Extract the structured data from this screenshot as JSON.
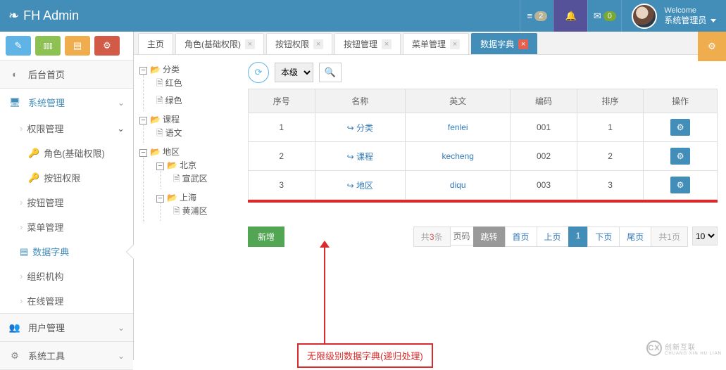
{
  "brand": "FH Admin",
  "nav": {
    "notif1_count": "2",
    "mail_count": "0",
    "welcome": "Welcome",
    "username": "系统管理员"
  },
  "sidebar": {
    "items": [
      {
        "icon": "◐",
        "label": "后台首页"
      },
      {
        "icon": "🖥",
        "label": "系统管理",
        "active": true
      },
      {
        "label": "权限管理"
      },
      {
        "label": "角色(基础权限)"
      },
      {
        "label": "按钮权限"
      },
      {
        "label": "按钮管理"
      },
      {
        "label": "菜单管理"
      },
      {
        "icon": "📘",
        "label": "数据字典",
        "selected": true
      },
      {
        "label": "组织机构"
      },
      {
        "label": "在线管理"
      },
      {
        "icon": "👥",
        "label": "用户管理"
      },
      {
        "icon": "⚙",
        "label": "系统工具"
      }
    ]
  },
  "tabs": [
    {
      "label": "主页",
      "closable": false
    },
    {
      "label": "角色(基础权限)",
      "closable": true
    },
    {
      "label": "按钮权限",
      "closable": true
    },
    {
      "label": "按钮管理",
      "closable": true
    },
    {
      "label": "菜单管理",
      "closable": true
    },
    {
      "label": "数据字典",
      "closable": true,
      "active": true
    }
  ],
  "tree": {
    "root": "分类",
    "root_children": [
      "红色",
      "绿色"
    ],
    "course": "课程",
    "course_children": [
      "语文"
    ],
    "region": "地区",
    "beijing": "北京",
    "beijing_children": [
      "宣武区"
    ],
    "shanghai": "上海",
    "shanghai_children": [
      "黄浦区"
    ]
  },
  "filter": {
    "level_option": "本级"
  },
  "table": {
    "headers": [
      "序号",
      "名称",
      "英文",
      "编码",
      "排序",
      "操作"
    ],
    "rows": [
      {
        "idx": "1",
        "name": "分类",
        "en": "fenlei",
        "code": "001",
        "sort": "1"
      },
      {
        "idx": "2",
        "name": "课程",
        "en": "kecheng",
        "code": "002",
        "sort": "2"
      },
      {
        "idx": "3",
        "name": "地区",
        "en": "diqu",
        "code": "003",
        "sort": "3"
      }
    ]
  },
  "buttons": {
    "add": "新增"
  },
  "pager": {
    "total_prefix": "共",
    "total_count": "3",
    "total_suffix": "条",
    "page_placeholder": "页码",
    "go": "跳转",
    "first": "首页",
    "prev": "上页",
    "current": "1",
    "next": "下页",
    "last": "尾页",
    "pages_prefix": "共",
    "pages_count": "1",
    "pages_suffix": "页",
    "size": "10"
  },
  "annotation": "无限级别数据字典(递归处理)",
  "watermark": {
    "logo": "CX",
    "line1": "创新互联",
    "line2": "CHUANG XIN HU LIAN"
  }
}
